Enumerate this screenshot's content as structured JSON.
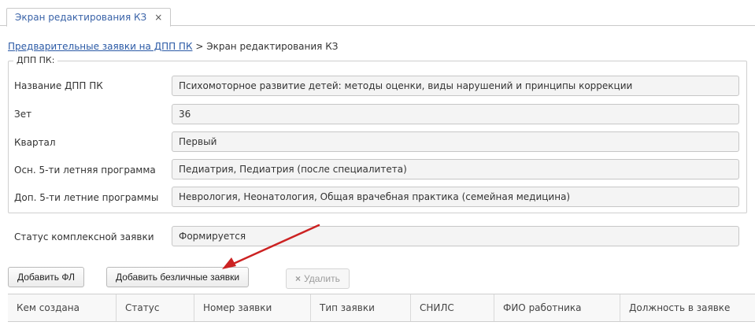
{
  "tabs": [
    {
      "label": "Экран редактирования КЗ",
      "close": "×"
    }
  ],
  "breadcrumb": {
    "link": "Предварительные заявки на ДПП ПК",
    "separator": ">",
    "current": "Экран редактирования КЗ"
  },
  "fieldset": {
    "legend": "ДПП ПК:",
    "rows": [
      {
        "label": "Название ДПП ПК",
        "value": "Психомоторное развитие детей: методы оценки, виды нарушений и принципы коррекции"
      },
      {
        "label": "Зет",
        "value": "36"
      },
      {
        "label": "Квартал",
        "value": "Первый"
      },
      {
        "label": "Осн. 5-ти летняя программа",
        "value": "Педиатрия, Педиатрия (после специалитета)"
      },
      {
        "label": "Доп. 5-ти летние программы",
        "value": "Неврология, Неонатология, Общая врачебная практика (семейная медицина)"
      }
    ]
  },
  "status": {
    "label": "Статус комплексной заявки",
    "value": "Формируется"
  },
  "toolbar": {
    "add_fl": "Добавить ФЛ",
    "add_impersonal": "Добавить безличные заявки",
    "delete": "Удалить",
    "delete_icon": "×"
  },
  "grid": {
    "columns": [
      "Кем создана",
      "Статус",
      "Номер заявки",
      "Тип заявки",
      "СНИЛС",
      "ФИО работника",
      "Должность в заявке"
    ]
  },
  "colors": {
    "link": "#2b5aa6",
    "annotation_arrow": "#cc2222"
  }
}
